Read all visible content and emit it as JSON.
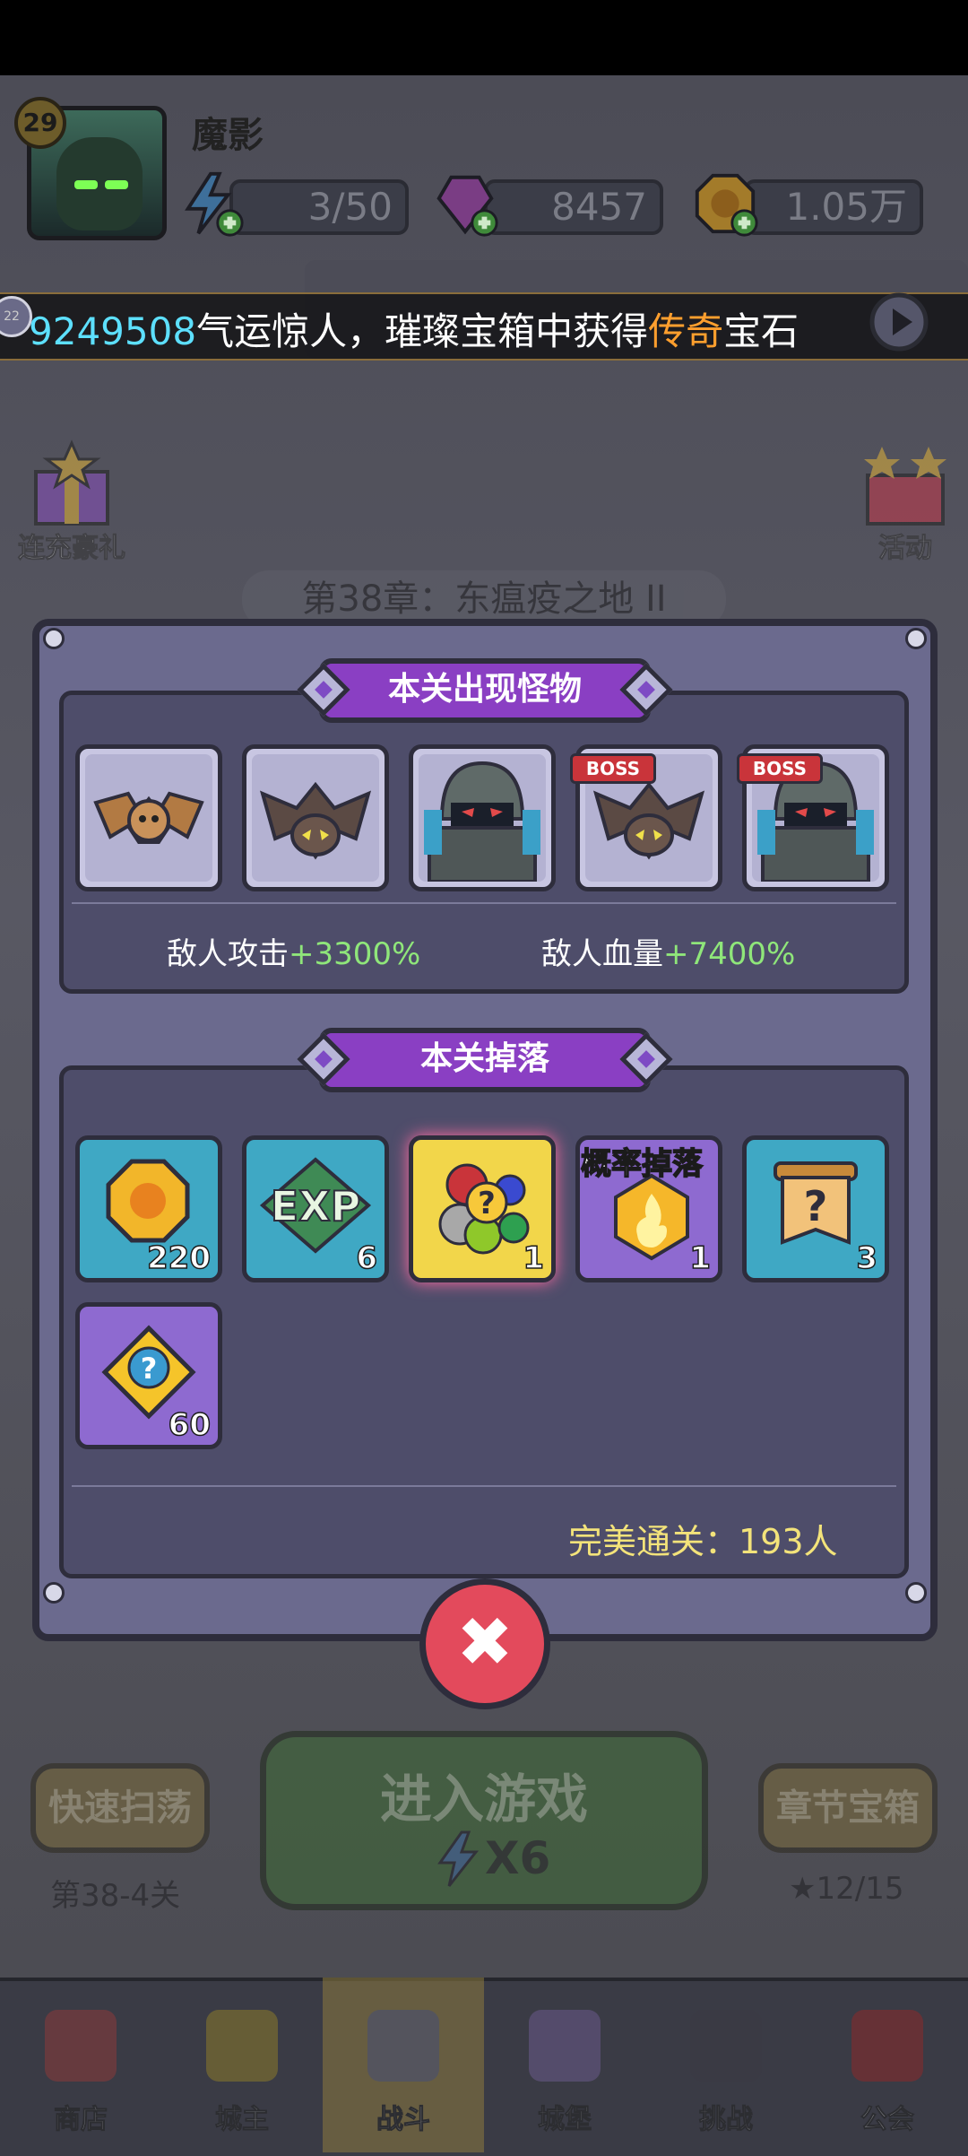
{
  "player": {
    "level": "29",
    "name": "魔影"
  },
  "resources": [
    {
      "name": "energy",
      "icon": "lightning-plus-icon",
      "value": "3/50"
    },
    {
      "name": "gems",
      "icon": "purple-gem-plus-icon",
      "value": "8457"
    },
    {
      "name": "gold",
      "icon": "gold-coin-plus-icon",
      "value": "1.05万"
    }
  ],
  "marquee": {
    "number": "9249508",
    "text_a": "气运惊人，璀璨宝箱中获得",
    "highlight": "传奇",
    "text_b": "宝石",
    "badge": "22"
  },
  "side_left": [
    {
      "label": "连充豪礼"
    }
  ],
  "side_right": [
    {
      "label": "活动"
    }
  ],
  "chapter_title": "第38章：东瘟疫之地 II",
  "modal": {
    "monsters_title": "本关出现怪物",
    "monsters": [
      {
        "icon": "orange-bat-icon",
        "boss": ""
      },
      {
        "icon": "dark-bat-icon",
        "boss": ""
      },
      {
        "icon": "armored-knight-icon",
        "boss": ""
      },
      {
        "icon": "dark-bat-icon",
        "boss": "BOSS"
      },
      {
        "icon": "armored-knight-icon",
        "boss": "BOSS"
      }
    ],
    "enemy_attack_label": "敌人攻击",
    "enemy_attack_value": "+3300%",
    "enemy_hp_label": "敌人血量",
    "enemy_hp_value": "+7400%",
    "drops_title": "本关掉落",
    "drops": [
      {
        "icon": "gold-coin-icon",
        "qty": "220",
        "tag": ""
      },
      {
        "icon": "exp-icon",
        "qty": "6",
        "tag": ""
      },
      {
        "icon": "mystery-gem-bag-icon",
        "qty": "1",
        "tag": ""
      },
      {
        "icon": "flame-crystal-icon",
        "qty": "1",
        "tag": "概率掉落"
      },
      {
        "icon": "mystery-scroll-icon",
        "qty": "3",
        "tag": ""
      },
      {
        "icon": "mystery-puzzle-icon",
        "qty": "60",
        "tag": ""
      }
    ],
    "perfect_clear": "完美通关：193人"
  },
  "quick_sweep": {
    "label": "快速扫荡",
    "stage": "第38-4关"
  },
  "enter_game": {
    "label": "进入游戏",
    "cost": "X6"
  },
  "chapter_chest": {
    "label": "章节宝箱",
    "stars": "12/15"
  },
  "bottom_nav": [
    {
      "label": "商店",
      "icon": "shop-icon"
    },
    {
      "label": "城主",
      "icon": "crown-icon"
    },
    {
      "label": "战斗",
      "icon": "crossed-swords-icon"
    },
    {
      "label": "城堡",
      "icon": "castle-icon"
    },
    {
      "label": "挑战",
      "icon": "demon-mask-icon"
    },
    {
      "label": "公会",
      "icon": "guild-banner-icon"
    }
  ],
  "colors": {
    "modal": "#6b6a8e",
    "panel": "#4e4d6a",
    "banner": "#8a3fc3",
    "stat_green": "#8fe67a",
    "close": "#e34a5c"
  }
}
